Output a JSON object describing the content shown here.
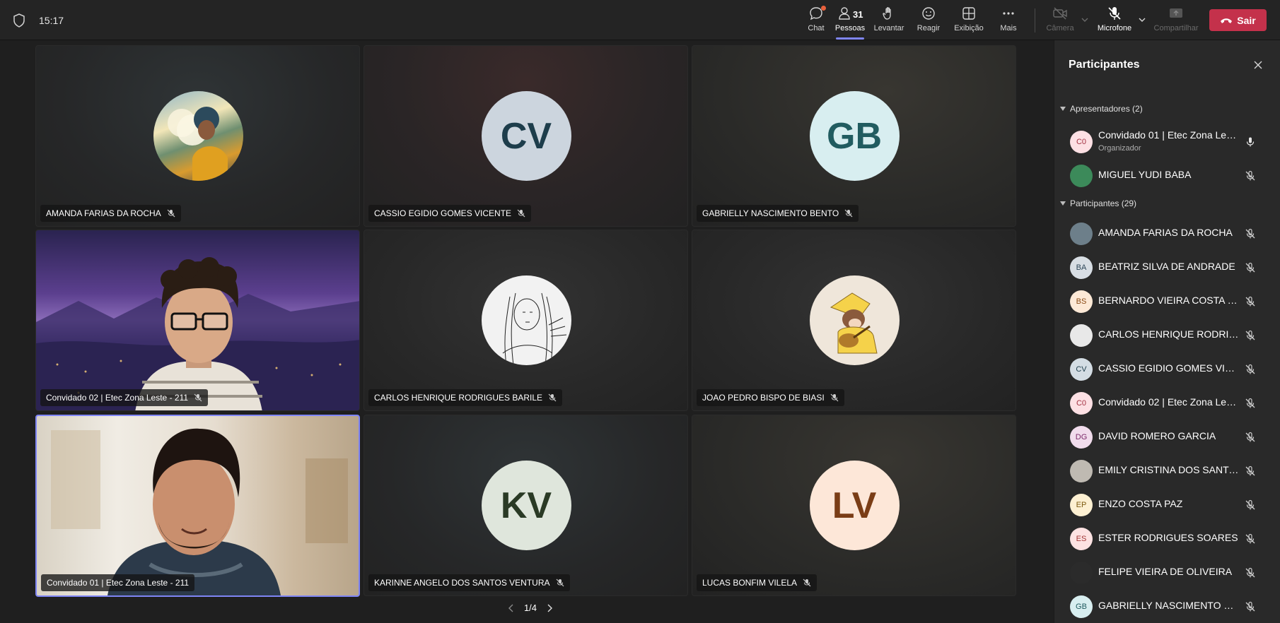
{
  "topbar": {
    "time": "15:17",
    "buttons": {
      "chat": "Chat",
      "people": "Pessoas",
      "people_count": "31",
      "raise": "Levantar",
      "react": "Reagir",
      "view": "Exibição",
      "more": "Mais",
      "camera": "Câmera",
      "mic": "Microfone",
      "share": "Compartilhar"
    },
    "leave_label": "Sair",
    "colors": {
      "leave": "#c4314b",
      "accent": "#7f85f5",
      "chat_badge": "#e8603c"
    }
  },
  "stage": {
    "tiles": [
      {
        "name": "AMANDA FARIAS DA ROCHA",
        "type": "photo-avatar",
        "icon": "anime-avatar-image"
      },
      {
        "name": "CASSIO EGIDIO GOMES VICENTE",
        "type": "initials",
        "initials": "CV",
        "avatar_bg": "#ccd5de",
        "avatar_fg": "#1d3d4b"
      },
      {
        "name": "GABRIELLY NASCIMENTO BENTO",
        "type": "initials",
        "initials": "GB",
        "avatar_bg": "#d8eef0",
        "avatar_fg": "#215c60"
      },
      {
        "name": "Convidado 02 | Etec Zona Leste - 211",
        "type": "video",
        "icon": "video-feed-person-glasses"
      },
      {
        "name": "CARLOS HENRIQUE RODRIGUES BARILE",
        "type": "photo-avatar",
        "icon": "manga-avatar-image"
      },
      {
        "name": "JOAO PEDRO BISPO DE BIASI",
        "type": "photo-avatar",
        "icon": "cartoon-avatar-image"
      },
      {
        "name": "Convidado 01 | Etec Zona Leste - 211",
        "type": "video",
        "icon": "video-feed-person-beard"
      },
      {
        "name": "KARINNE ANGELO DOS SANTOS VENTURA",
        "type": "initials",
        "initials": "KV",
        "avatar_bg": "#dfe6dc",
        "avatar_fg": "#2a3a25"
      },
      {
        "name": "LUCAS BONFIM VILELA",
        "type": "initials",
        "initials": "LV",
        "avatar_bg": "#fde7d8",
        "avatar_fg": "#7a3d16"
      }
    ],
    "pager": "1/4"
  },
  "panel": {
    "title": "Participantes",
    "presenters_header": "Apresentadores (2)",
    "participants_header": "Participantes (29)",
    "presenters": [
      {
        "name": "Convidado 01 | Etec Zona Lest...",
        "sub": "Organizador",
        "initials": "C0",
        "avatar_bg": "#fde0e4",
        "avatar_fg": "#a33343",
        "mic": "on"
      },
      {
        "name": "MIGUEL YUDI BABA",
        "initials": "",
        "avatar_bg": "#3c8a5a",
        "avatar_fg": "#fff",
        "mic": "off",
        "icon": "photo-avatar"
      }
    ],
    "participants": [
      {
        "name": "AMANDA FARIAS DA ROCHA",
        "initials": "",
        "avatar_bg": "#6d7f8a",
        "avatar_fg": "#fff",
        "icon": "photo-avatar"
      },
      {
        "name": "BEATRIZ SILVA DE ANDRADE",
        "initials": "BA",
        "avatar_bg": "#d8dee4",
        "avatar_fg": "#2d4658"
      },
      {
        "name": "BERNARDO VIEIRA COSTA DO...",
        "initials": "BS",
        "avatar_bg": "#fde9d6",
        "avatar_fg": "#8a4a14"
      },
      {
        "name": "CARLOS HENRIQUE RODRIGU...",
        "initials": "",
        "avatar_bg": "#e8e8e8",
        "avatar_fg": "#333",
        "icon": "photo-avatar"
      },
      {
        "name": "CASSIO EGIDIO GOMES VICE...",
        "initials": "CV",
        "avatar_bg": "#d4dde4",
        "avatar_fg": "#1d3d4b"
      },
      {
        "name": "Convidado 02 | Etec Zona Lest...",
        "initials": "C0",
        "avatar_bg": "#fde0e4",
        "avatar_fg": "#a33343"
      },
      {
        "name": "DAVID ROMERO GARCIA",
        "initials": "DG",
        "avatar_bg": "#f1dcec",
        "avatar_fg": "#7c2a6a"
      },
      {
        "name": "EMILY CRISTINA DOS SANTOS...",
        "initials": "",
        "avatar_bg": "#bfbab2",
        "avatar_fg": "#333",
        "icon": "photo-avatar"
      },
      {
        "name": "ENZO COSTA PAZ",
        "initials": "EP",
        "avatar_bg": "#fdf0d2",
        "avatar_fg": "#7d5a10"
      },
      {
        "name": "ESTER RODRIGUES SOARES",
        "initials": "ES",
        "avatar_bg": "#fde2e2",
        "avatar_fg": "#a13535"
      },
      {
        "name": "FELIPE VIEIRA DE OLIVEIRA",
        "initials": "",
        "avatar_bg": "#2b2b2b",
        "avatar_fg": "#fff",
        "icon": "photo-avatar"
      },
      {
        "name": "GABRIELLY NASCIMENTO BEN...",
        "initials": "GB",
        "avatar_bg": "#d8eef0",
        "avatar_fg": "#215c60"
      }
    ]
  }
}
